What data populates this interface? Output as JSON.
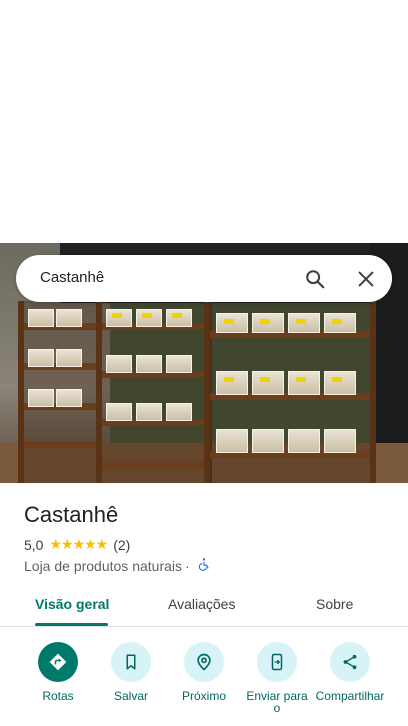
{
  "search": {
    "query": "Castanhê"
  },
  "place": {
    "name": "Castanhê",
    "rating": "5,0",
    "stars": "★★★★★",
    "reviews": "(2)",
    "category": "Loja de produtos naturais",
    "separator": "·"
  },
  "tabs": [
    {
      "label": "Visão geral",
      "active": true
    },
    {
      "label": "Avaliações",
      "active": false
    },
    {
      "label": "Sobre",
      "active": false
    }
  ],
  "actions": [
    {
      "label": "Rotas",
      "icon": "directions-icon"
    },
    {
      "label": "Salvar",
      "icon": "bookmark-icon"
    },
    {
      "label": "Próximo",
      "icon": "nearby-icon"
    },
    {
      "label": "Enviar para o",
      "icon": "send-to-phone-icon"
    },
    {
      "label": "Compartilhar",
      "icon": "share-icon"
    }
  ],
  "colors": {
    "accent": "#00796b",
    "button_bg": "#d7f3f7",
    "star": "#fbbc04",
    "accessibility": "#1a73e8"
  }
}
